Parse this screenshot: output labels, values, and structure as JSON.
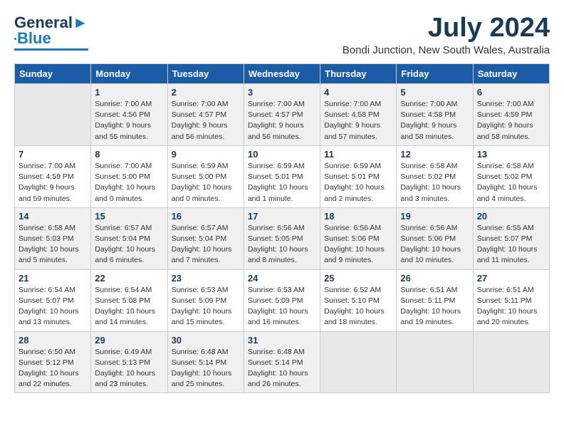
{
  "header": {
    "logo_line1": "General",
    "logo_line2": "Blue",
    "month": "July 2024",
    "location": "Bondi Junction, New South Wales, Australia"
  },
  "weekdays": [
    "Sunday",
    "Monday",
    "Tuesday",
    "Wednesday",
    "Thursday",
    "Friday",
    "Saturday"
  ],
  "weeks": [
    [
      {
        "day": "",
        "info": ""
      },
      {
        "day": "1",
        "info": "Sunrise: 7:00 AM\nSunset: 4:56 PM\nDaylight: 9 hours\nand 55 minutes."
      },
      {
        "day": "2",
        "info": "Sunrise: 7:00 AM\nSunset: 4:57 PM\nDaylight: 9 hours\nand 56 minutes."
      },
      {
        "day": "3",
        "info": "Sunrise: 7:00 AM\nSunset: 4:57 PM\nDaylight: 9 hours\nand 56 minutes."
      },
      {
        "day": "4",
        "info": "Sunrise: 7:00 AM\nSunset: 4:58 PM\nDaylight: 9 hours\nand 57 minutes."
      },
      {
        "day": "5",
        "info": "Sunrise: 7:00 AM\nSunset: 4:58 PM\nDaylight: 9 hours\nand 58 minutes."
      },
      {
        "day": "6",
        "info": "Sunrise: 7:00 AM\nSunset: 4:59 PM\nDaylight: 9 hours\nand 58 minutes."
      }
    ],
    [
      {
        "day": "7",
        "info": "Sunrise: 7:00 AM\nSunset: 4:59 PM\nDaylight: 9 hours\nand 59 minutes."
      },
      {
        "day": "8",
        "info": "Sunrise: 7:00 AM\nSunset: 5:00 PM\nDaylight: 10 hours\nand 0 minutes."
      },
      {
        "day": "9",
        "info": "Sunrise: 6:59 AM\nSunset: 5:00 PM\nDaylight: 10 hours\nand 0 minutes."
      },
      {
        "day": "10",
        "info": "Sunrise: 6:59 AM\nSunset: 5:01 PM\nDaylight: 10 hours\nand 1 minute."
      },
      {
        "day": "11",
        "info": "Sunrise: 6:59 AM\nSunset: 5:01 PM\nDaylight: 10 hours\nand 2 minutes."
      },
      {
        "day": "12",
        "info": "Sunrise: 6:58 AM\nSunset: 5:02 PM\nDaylight: 10 hours\nand 3 minutes."
      },
      {
        "day": "13",
        "info": "Sunrise: 6:58 AM\nSunset: 5:02 PM\nDaylight: 10 hours\nand 4 minutes."
      }
    ],
    [
      {
        "day": "14",
        "info": "Sunrise: 6:58 AM\nSunset: 5:03 PM\nDaylight: 10 hours\nand 5 minutes."
      },
      {
        "day": "15",
        "info": "Sunrise: 6:57 AM\nSunset: 5:04 PM\nDaylight: 10 hours\nand 6 minutes."
      },
      {
        "day": "16",
        "info": "Sunrise: 6:57 AM\nSunset: 5:04 PM\nDaylight: 10 hours\nand 7 minutes."
      },
      {
        "day": "17",
        "info": "Sunrise: 6:56 AM\nSunset: 5:05 PM\nDaylight: 10 hours\nand 8 minutes."
      },
      {
        "day": "18",
        "info": "Sunrise: 6:56 AM\nSunset: 5:06 PM\nDaylight: 10 hours\nand 9 minutes."
      },
      {
        "day": "19",
        "info": "Sunrise: 6:56 AM\nSunset: 5:06 PM\nDaylight: 10 hours\nand 10 minutes."
      },
      {
        "day": "20",
        "info": "Sunrise: 6:55 AM\nSunset: 5:07 PM\nDaylight: 10 hours\nand 11 minutes."
      }
    ],
    [
      {
        "day": "21",
        "info": "Sunrise: 6:54 AM\nSunset: 5:07 PM\nDaylight: 10 hours\nand 13 minutes."
      },
      {
        "day": "22",
        "info": "Sunrise: 6:54 AM\nSunset: 5:08 PM\nDaylight: 10 hours\nand 14 minutes."
      },
      {
        "day": "23",
        "info": "Sunrise: 6:53 AM\nSunset: 5:09 PM\nDaylight: 10 hours\nand 15 minutes."
      },
      {
        "day": "24",
        "info": "Sunrise: 6:53 AM\nSunset: 5:09 PM\nDaylight: 10 hours\nand 16 minutes."
      },
      {
        "day": "25",
        "info": "Sunrise: 6:52 AM\nSunset: 5:10 PM\nDaylight: 10 hours\nand 18 minutes."
      },
      {
        "day": "26",
        "info": "Sunrise: 6:51 AM\nSunset: 5:11 PM\nDaylight: 10 hours\nand 19 minutes."
      },
      {
        "day": "27",
        "info": "Sunrise: 6:51 AM\nSunset: 5:11 PM\nDaylight: 10 hours\nand 20 minutes."
      }
    ],
    [
      {
        "day": "28",
        "info": "Sunrise: 6:50 AM\nSunset: 5:12 PM\nDaylight: 10 hours\nand 22 minutes."
      },
      {
        "day": "29",
        "info": "Sunrise: 6:49 AM\nSunset: 5:13 PM\nDaylight: 10 hours\nand 23 minutes."
      },
      {
        "day": "30",
        "info": "Sunrise: 6:48 AM\nSunset: 5:14 PM\nDaylight: 10 hours\nand 25 minutes."
      },
      {
        "day": "31",
        "info": "Sunrise: 6:48 AM\nSunset: 5:14 PM\nDaylight: 10 hours\nand 26 minutes."
      },
      {
        "day": "",
        "info": ""
      },
      {
        "day": "",
        "info": ""
      },
      {
        "day": "",
        "info": ""
      }
    ]
  ]
}
